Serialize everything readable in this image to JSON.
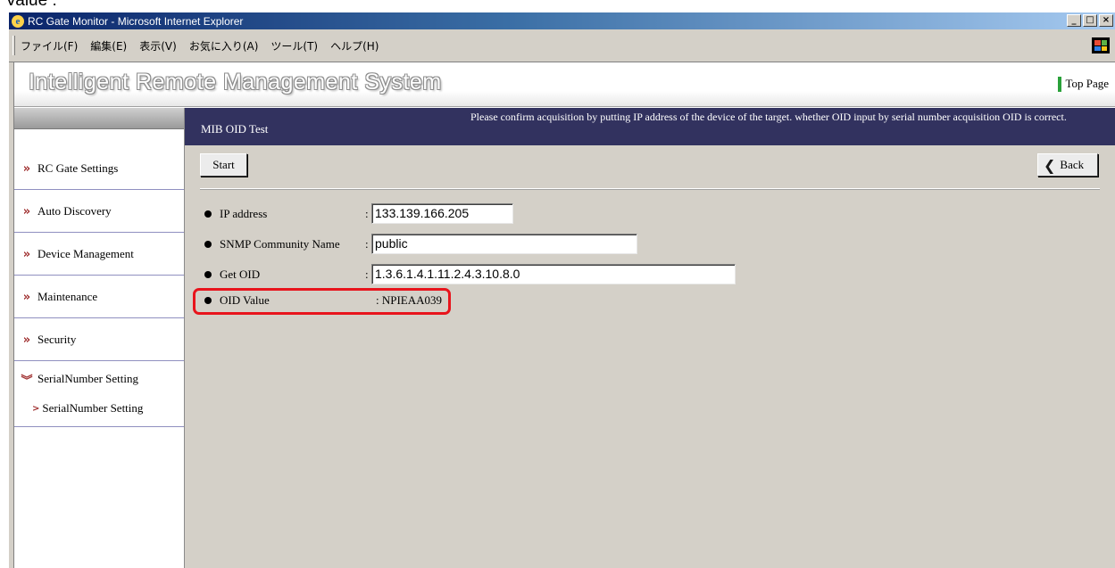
{
  "caption": "Value :",
  "window": {
    "title": "RC Gate Monitor - Microsoft Internet Explorer",
    "controls": [
      "minimize-icon",
      "maximize-icon",
      "close-icon"
    ]
  },
  "menu": {
    "items": [
      "ファイル(F)",
      "編集(E)",
      "表示(V)",
      "お気に入り(A)",
      "ツール(T)",
      "ヘルプ(H)"
    ]
  },
  "header": {
    "title": "Intelligent Remote Management System",
    "top_page_link": "Top Page"
  },
  "sidebar": {
    "items": [
      {
        "label": "RC Gate Settings",
        "icon": "double-chevron-right-icon"
      },
      {
        "label": "Auto Discovery",
        "icon": "double-chevron-right-icon"
      },
      {
        "label": "Device Management",
        "icon": "double-chevron-right-icon"
      },
      {
        "label": "Maintenance",
        "icon": "double-chevron-right-icon"
      },
      {
        "label": "Security",
        "icon": "double-chevron-right-icon"
      },
      {
        "label": "SerialNumber Setting",
        "icon": "double-chevron-down-icon"
      }
    ],
    "sub_items": [
      {
        "label": "SerialNumber Setting",
        "icon": "triangle-right-icon"
      }
    ]
  },
  "content": {
    "page_name": "MIB OID Test",
    "note": "Please confirm acquisition by putting IP address of the device of the target. whether OID input by serial number acquisition OID is correct.",
    "start_button": "Start",
    "back_button": "Back",
    "fields": {
      "ip_address": {
        "label": "IP address",
        "value": "133.139.166.205"
      },
      "community": {
        "label": "SNMP Community Name",
        "value": "public"
      },
      "get_oid": {
        "label": "Get OID",
        "value": "1.3.6.1.4.1.11.2.4.3.10.8.0"
      },
      "oid_value": {
        "label": "OID Value",
        "value": ": NPIEAA039"
      }
    },
    "colon": ":"
  },
  "colors": {
    "content_header_bg": "#32325f",
    "content_bg": "#d4d0c8",
    "highlight": "#e8141c",
    "chevron": "#a03030"
  }
}
